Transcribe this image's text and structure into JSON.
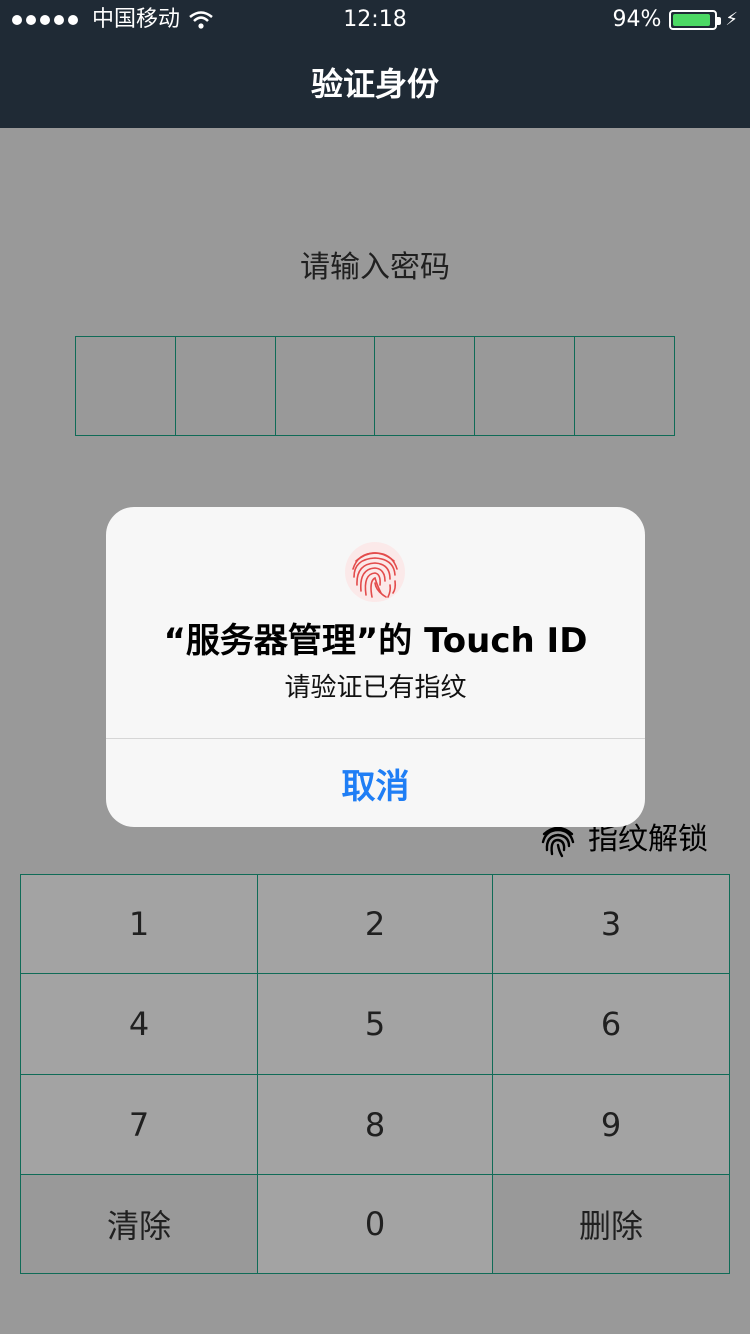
{
  "status_bar": {
    "carrier": "中国移动",
    "time": "12:18",
    "battery_percent_text": "94%",
    "battery_level": 0.94
  },
  "nav": {
    "title": "验证身份"
  },
  "password": {
    "prompt": "请输入密码",
    "digits": 6
  },
  "fingerprint_unlock": {
    "label": "指纹解锁",
    "icon": "fingerprint-icon"
  },
  "keypad": {
    "keys": [
      "1",
      "2",
      "3",
      "4",
      "5",
      "6",
      "7",
      "8",
      "9",
      "清除",
      "0",
      "删除"
    ]
  },
  "alert": {
    "title": "“服务器管理”的 Touch ID",
    "message": "请验证已有指纹",
    "cancel": "取消",
    "icon": "fingerprint-icon"
  },
  "colors": {
    "nav_bg": "#1f2a35",
    "accent_green": "#19a889",
    "alert_button_blue": "#1f7ef5",
    "fingerprint_red": "#e34b4b",
    "battery_green": "#4cd964"
  }
}
